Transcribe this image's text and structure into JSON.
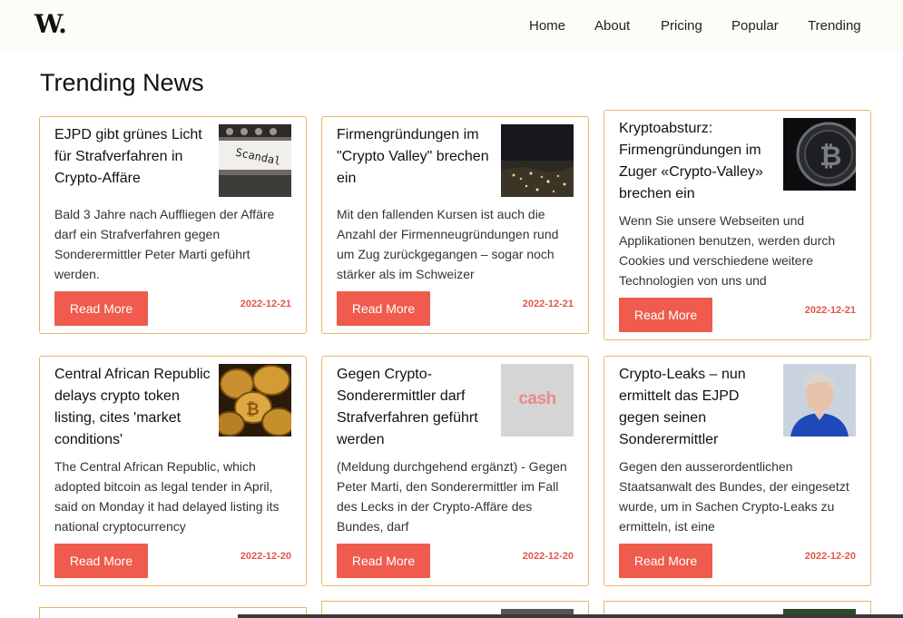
{
  "brand": {
    "logo": "W."
  },
  "nav": {
    "items": [
      {
        "label": "Home"
      },
      {
        "label": "About"
      },
      {
        "label": "Pricing"
      },
      {
        "label": "Popular"
      },
      {
        "label": "Trending"
      }
    ]
  },
  "page": {
    "title": "Trending News"
  },
  "cards": [
    {
      "title": "EJPD gibt grünes Licht für Strafverfahren in Crypto-Affäre",
      "excerpt": "Bald 3 Jahre nach Auffliegen der Affäre darf ein Strafverfahren gegen Sonderermittler Peter Marti geführt werden.",
      "date": "2022-12-21",
      "button": "Read More",
      "thumb_caption": "Scandal"
    },
    {
      "title": "Firmengründungen im \"Crypto Valley\" brechen ein",
      "excerpt": "Mit den fallenden Kursen ist auch die Anzahl der Firmenneugründungen rund um Zug zurückgegangen – sogar noch stärker als im Schweizer",
      "date": "2022-12-21",
      "button": "Read More"
    },
    {
      "title": "Kryptoabsturz: Firmengründungen im Zuger «Crypto-Valley» brechen ein",
      "excerpt": "Wenn Sie unsere Webseiten und Applikationen benutzen, werden durch Cookies und verschiedene weitere Technologien von uns und",
      "date": "2022-12-21",
      "button": "Read More"
    },
    {
      "title": "Central African Republic delays crypto token listing, cites 'market conditions'",
      "excerpt": "The Central African Republic, which adopted bitcoin as legal tender in April, said on Monday it had delayed listing its national cryptocurrency",
      "date": "2022-12-20",
      "button": "Read More"
    },
    {
      "title": "Gegen Crypto-Sonderermittler darf Strafverfahren geführt werden",
      "excerpt": "(Meldung durchgehend ergänzt) - Gegen Peter Marti, den Sonderermittler im Fall des Lecks in der Crypto-Affäre des Bundes, darf",
      "date": "2022-12-20",
      "button": "Read More",
      "thumb_caption": "cash"
    },
    {
      "title": "Crypto-Leaks – nun ermittelt das EJPD gegen seinen Sonderermittler",
      "excerpt": "Gegen den ausserordentlichen Staatsanwalt des Bundes, der eingesetzt wurde, um in Sachen Crypto-Leaks zu ermitteln, ist eine",
      "date": "2022-12-20",
      "button": "Read More"
    }
  ]
}
